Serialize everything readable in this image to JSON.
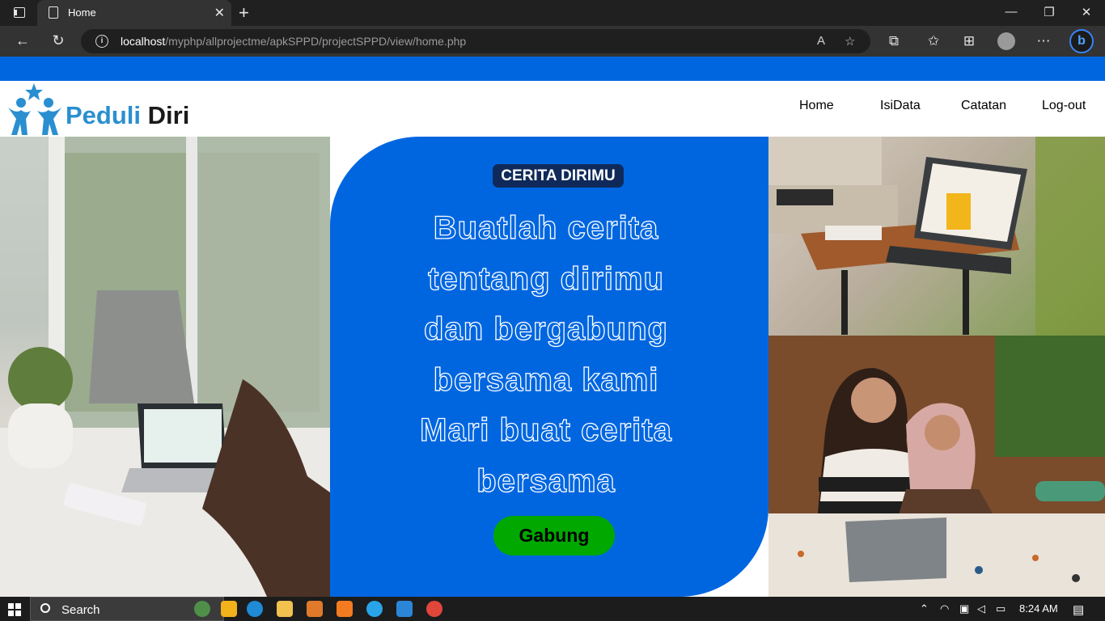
{
  "browser": {
    "tab_title": "Home",
    "url_host": "localhost",
    "url_path": "/myphp/allprojectme/apkSPPD/projectSPPD/view/home.php"
  },
  "site": {
    "logo_word1": "Peduli",
    "logo_word2": "Diri",
    "nav": [
      "Home",
      "IsiData",
      "Catatan",
      "Log-out"
    ]
  },
  "hero": {
    "badge": "CERITA DIRIMU",
    "headline_lines": [
      "Buatlah cerita",
      "tentang dirimu",
      "dan bergabung",
      "bersama kami",
      "Mari buat cerita",
      "bersama"
    ],
    "cta_label": "Gabung"
  },
  "taskbar": {
    "search_label": "Search",
    "time": "8:24 AM"
  },
  "colors": {
    "brand_blue": "#0066e0",
    "cta_green": "#00a800",
    "badge_navy": "#0f2a5a"
  }
}
